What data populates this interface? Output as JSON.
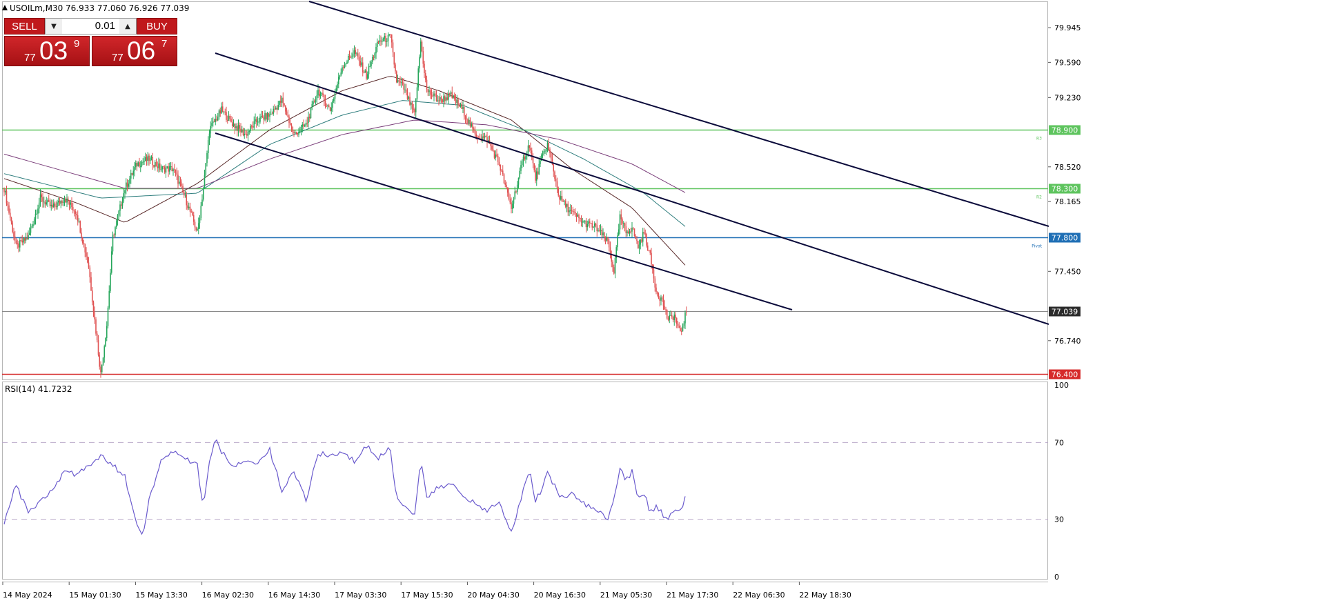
{
  "header": {
    "symbol_line": "USOILm,M30  76.933 77.060 76.926 77.039",
    "rsi_label": "RSI(14) 41.7232"
  },
  "trade_panel": {
    "sell_label": "SELL",
    "buy_label": "BUY",
    "lot": "0.01",
    "sell_price": {
      "small": "77",
      "big": "03",
      "sup": "9"
    },
    "buy_price": {
      "small": "77",
      "big": "06",
      "sup": "7"
    }
  },
  "colors": {
    "bull": "#26a65b",
    "bear": "#e05252",
    "channel": "#0b0b3b",
    "r3": "#5ec45e",
    "r2": "#5ec45e",
    "pivot": "#1f6fb5",
    "s1": "#d62a2a",
    "rsi": "#6a5acd"
  },
  "levels": [
    {
      "name": "R3",
      "value": 78.9,
      "tag": "78.900",
      "color": "#5ec45e"
    },
    {
      "name": "R2",
      "value": 78.3,
      "tag": "78.300",
      "color": "#5ec45e"
    },
    {
      "name": "Pivot",
      "value": 77.8,
      "tag": "77.800",
      "color": "#1f6fb5"
    },
    {
      "name": "",
      "value": 76.4,
      "tag": "76.400",
      "color": "#d62a2a"
    }
  ],
  "current_price": {
    "value": 77.039,
    "tag": "77.039"
  },
  "chart_data": {
    "type": "candlestick",
    "symbol": "USOILm",
    "timeframe": "M30",
    "price_ticks": [
      "79.945",
      "79.590",
      "79.230",
      "78.520",
      "78.165",
      "77.450",
      "76.740"
    ],
    "price_tick_values": [
      79.945,
      79.59,
      79.23,
      78.52,
      78.165,
      77.45,
      76.74
    ],
    "x_tick_labels": [
      "14 May 2024",
      "15 May 01:30",
      "15 May 13:30",
      "16 May 02:30",
      "16 May 14:30",
      "17 May 03:30",
      "17 May 15:30",
      "20 May 04:30",
      "20 May 16:30",
      "21 May 05:30",
      "21 May 17:30",
      "22 May 06:30",
      "22 May 18:30"
    ],
    "ylim": [
      76.35,
      80.2
    ],
    "close_path": [
      [
        0,
        78.3
      ],
      [
        10,
        77.7
      ],
      [
        20,
        77.8
      ],
      [
        30,
        78.2
      ],
      [
        40,
        78.1
      ],
      [
        50,
        78.2
      ],
      [
        60,
        78.05
      ],
      [
        70,
        77.5
      ],
      [
        80,
        76.4
      ],
      [
        85,
        76.9
      ],
      [
        90,
        77.8
      ],
      [
        100,
        78.3
      ],
      [
        110,
        78.55
      ],
      [
        120,
        78.6
      ],
      [
        130,
        78.5
      ],
      [
        140,
        78.5
      ],
      [
        150,
        78.2
      ],
      [
        160,
        77.85
      ],
      [
        165,
        78.3
      ],
      [
        170,
        78.9
      ],
      [
        180,
        79.1
      ],
      [
        190,
        78.95
      ],
      [
        200,
        78.85
      ],
      [
        210,
        79.0
      ],
      [
        220,
        79.05
      ],
      [
        230,
        79.2
      ],
      [
        240,
        78.85
      ],
      [
        250,
        78.95
      ],
      [
        260,
        79.3
      ],
      [
        270,
        79.1
      ],
      [
        280,
        79.55
      ],
      [
        290,
        79.7
      ],
      [
        300,
        79.45
      ],
      [
        310,
        79.8
      ],
      [
        320,
        79.85
      ],
      [
        325,
        79.4
      ],
      [
        330,
        79.35
      ],
      [
        340,
        79.05
      ],
      [
        345,
        79.8
      ],
      [
        350,
        79.3
      ],
      [
        360,
        79.2
      ],
      [
        370,
        79.25
      ],
      [
        380,
        79.1
      ],
      [
        390,
        78.85
      ],
      [
        400,
        78.8
      ],
      [
        410,
        78.55
      ],
      [
        420,
        78.1
      ],
      [
        430,
        78.6
      ],
      [
        435,
        78.75
      ],
      [
        440,
        78.4
      ],
      [
        445,
        78.6
      ],
      [
        450,
        78.75
      ],
      [
        460,
        78.2
      ],
      [
        470,
        78.05
      ],
      [
        480,
        77.95
      ],
      [
        490,
        77.9
      ],
      [
        500,
        77.75
      ],
      [
        505,
        77.45
      ],
      [
        510,
        78.0
      ],
      [
        515,
        77.85
      ],
      [
        520,
        77.9
      ],
      [
        525,
        77.7
      ],
      [
        530,
        77.85
      ],
      [
        535,
        77.6
      ],
      [
        540,
        77.25
      ],
      [
        545,
        77.15
      ],
      [
        550,
        76.95
      ],
      [
        555,
        77.0
      ],
      [
        560,
        76.8
      ],
      [
        565,
        77.05
      ]
    ],
    "moving_averages": [
      {
        "color": "#5a2a2a",
        "points": [
          [
            0,
            78.4
          ],
          [
            60,
            78.15
          ],
          [
            100,
            77.95
          ],
          [
            160,
            78.35
          ],
          [
            220,
            78.9
          ],
          [
            280,
            79.3
          ],
          [
            320,
            79.45
          ],
          [
            360,
            79.3
          ],
          [
            420,
            79.0
          ],
          [
            470,
            78.5
          ],
          [
            520,
            78.1
          ],
          [
            565,
            77.5
          ]
        ]
      },
      {
        "color": "#2e7d7d",
        "points": [
          [
            0,
            78.45
          ],
          [
            80,
            78.2
          ],
          [
            160,
            78.25
          ],
          [
            220,
            78.75
          ],
          [
            280,
            79.05
          ],
          [
            330,
            79.2
          ],
          [
            380,
            79.15
          ],
          [
            430,
            78.9
          ],
          [
            480,
            78.6
          ],
          [
            530,
            78.25
          ],
          [
            565,
            77.9
          ]
        ]
      },
      {
        "color": "#7b3f7b",
        "points": [
          [
            0,
            78.65
          ],
          [
            100,
            78.3
          ],
          [
            160,
            78.3
          ],
          [
            220,
            78.6
          ],
          [
            280,
            78.85
          ],
          [
            340,
            79.0
          ],
          [
            400,
            78.95
          ],
          [
            460,
            78.8
          ],
          [
            520,
            78.55
          ],
          [
            565,
            78.25
          ]
        ]
      }
    ],
    "channel_lines": [
      {
        "from": [
          448,
          2
        ],
        "to": [
          1520,
          328
        ]
      },
      {
        "from": [
          312,
          77
        ],
        "to": [
          1520,
          470
        ]
      },
      {
        "from": [
          312,
          193
        ],
        "to": [
          1148,
          449
        ]
      }
    ],
    "rsi": {
      "ylim": [
        0,
        100
      ],
      "levels": [
        30,
        70
      ],
      "ticks": [
        "100",
        "70",
        "30",
        "0"
      ],
      "values": [
        [
          0,
          28
        ],
        [
          10,
          48
        ],
        [
          20,
          33
        ],
        [
          30,
          40
        ],
        [
          40,
          45
        ],
        [
          50,
          55
        ],
        [
          60,
          53
        ],
        [
          70,
          58
        ],
        [
          80,
          63
        ],
        [
          90,
          58
        ],
        [
          100,
          52
        ],
        [
          110,
          28
        ],
        [
          115,
          22
        ],
        [
          120,
          40
        ],
        [
          130,
          60
        ],
        [
          140,
          65
        ],
        [
          150,
          62
        ],
        [
          160,
          58
        ],
        [
          165,
          35
        ],
        [
          170,
          60
        ],
        [
          175,
          71
        ],
        [
          180,
          65
        ],
        [
          190,
          58
        ],
        [
          200,
          60
        ],
        [
          210,
          58
        ],
        [
          220,
          66
        ],
        [
          230,
          45
        ],
        [
          240,
          55
        ],
        [
          250,
          40
        ],
        [
          260,
          65
        ],
        [
          270,
          62
        ],
        [
          280,
          66
        ],
        [
          290,
          60
        ],
        [
          300,
          68
        ],
        [
          310,
          62
        ],
        [
          320,
          67
        ],
        [
          325,
          40
        ],
        [
          330,
          38
        ],
        [
          340,
          33
        ],
        [
          345,
          62
        ],
        [
          350,
          42
        ],
        [
          360,
          47
        ],
        [
          370,
          48
        ],
        [
          380,
          42
        ],
        [
          390,
          38
        ],
        [
          400,
          34
        ],
        [
          410,
          40
        ],
        [
          420,
          23
        ],
        [
          430,
          45
        ],
        [
          435,
          55
        ],
        [
          440,
          40
        ],
        [
          445,
          45
        ],
        [
          450,
          55
        ],
        [
          460,
          42
        ],
        [
          470,
          43
        ],
        [
          480,
          38
        ],
        [
          490,
          35
        ],
        [
          500,
          30
        ],
        [
          505,
          40
        ],
        [
          510,
          57
        ],
        [
          515,
          50
        ],
        [
          520,
          55
        ],
        [
          525,
          40
        ],
        [
          530,
          44
        ],
        [
          535,
          34
        ],
        [
          540,
          36
        ],
        [
          545,
          33
        ],
        [
          550,
          30
        ],
        [
          555,
          34
        ],
        [
          560,
          35
        ],
        [
          565,
          42
        ]
      ]
    }
  }
}
